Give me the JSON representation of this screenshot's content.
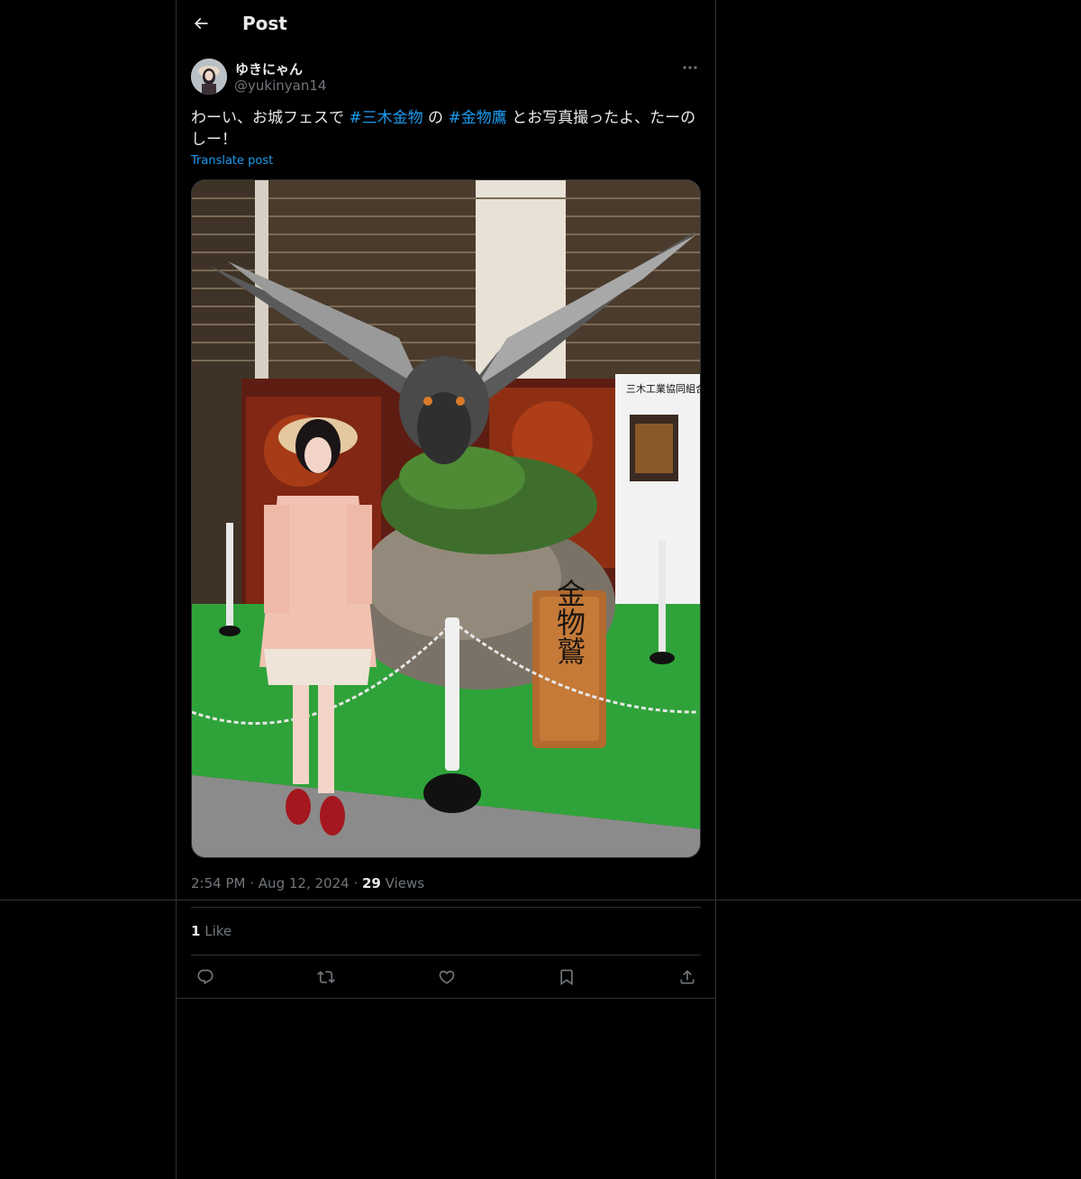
{
  "header": {
    "title": "Post"
  },
  "author": {
    "display_name": "ゆきにゃん",
    "handle": "@yukinyan14"
  },
  "post": {
    "text_before": "わーい、お城フェスで ",
    "hashtag_1": "#三木金物",
    "text_middle": " の ",
    "hashtag_2": "#金物鷹",
    "text_after": " とお写真撮ったよ、たーのしー！",
    "translate_label": "Translate post"
  },
  "media": {
    "sign_text": "三木工業協同組合",
    "plaque_text": "金物鷲"
  },
  "meta": {
    "time": "2:54 PM",
    "separator": "·",
    "date": "Aug 12, 2024",
    "views_count": "29",
    "views_label": "Views"
  },
  "engagement": {
    "likes_count": "1",
    "likes_label": "Like"
  },
  "actions": [
    {
      "name": "reply",
      "icon": "reply-icon"
    },
    {
      "name": "repost",
      "icon": "repost-icon"
    },
    {
      "name": "like",
      "icon": "heart-icon"
    },
    {
      "name": "bookmark",
      "icon": "bookmark-icon"
    },
    {
      "name": "share",
      "icon": "share-icon"
    }
  ]
}
